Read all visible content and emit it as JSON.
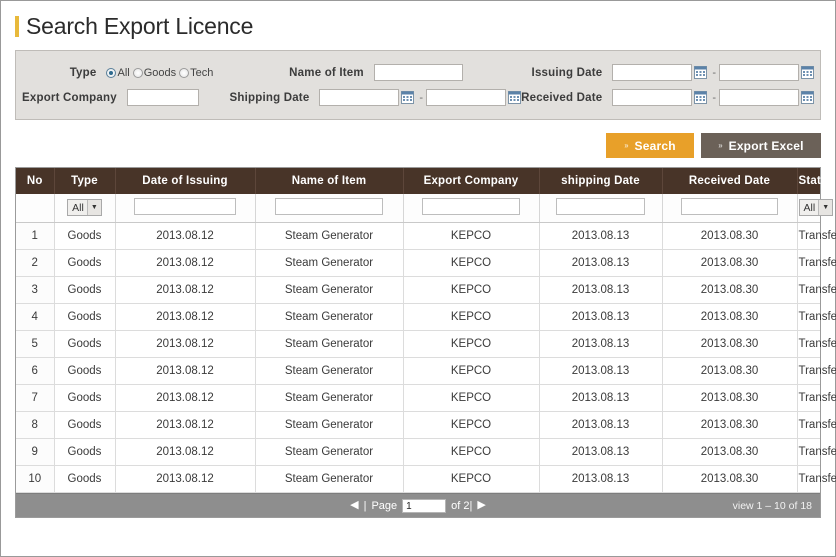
{
  "page_title": "Search Export Licence",
  "search_panel": {
    "type_label": "Type",
    "type_options": [
      {
        "label": "All",
        "selected": true
      },
      {
        "label": "Goods",
        "selected": false
      },
      {
        "label": "Tech",
        "selected": false
      }
    ],
    "name_of_item_label": "Name of Item",
    "name_of_item_value": "",
    "issuing_date_label": "Issuing Date",
    "issuing_date_from": "",
    "issuing_date_to": "",
    "export_company_label": "Export Company",
    "export_company_value": "",
    "shipping_date_label": "Shipping Date",
    "shipping_date_from": "",
    "shipping_date_to": "",
    "received_date_label": "Received Date",
    "received_date_from": "",
    "received_date_to": "",
    "date_separator": "-"
  },
  "actions": {
    "search_label": "Search",
    "export_excel_label": "Export Excel",
    "arrow_glyph": "››"
  },
  "table": {
    "columns": [
      "No",
      "Type",
      "Date of Issuing",
      "Name of Item",
      "Export Company",
      "shipping Date",
      "Received Date",
      "Status"
    ],
    "filters": {
      "type": {
        "kind": "select",
        "value": "All"
      },
      "date_of_issuing": {
        "kind": "text",
        "value": ""
      },
      "name_of_item": {
        "kind": "text",
        "value": ""
      },
      "export_company": {
        "kind": "text",
        "value": ""
      },
      "shipping_date": {
        "kind": "text",
        "value": ""
      },
      "received_date": {
        "kind": "text",
        "value": ""
      },
      "status": {
        "kind": "select",
        "value": "All"
      }
    },
    "rows": [
      {
        "no": "1",
        "type": "Goods",
        "date_of_issuing": "2013.08.12",
        "name_of_item": "Steam Generator",
        "export_company": "KEPCO",
        "shipping_date": "2013.08.13",
        "received_date": "2013.08.30",
        "status": "Transferred"
      },
      {
        "no": "2",
        "type": "Goods",
        "date_of_issuing": "2013.08.12",
        "name_of_item": "Steam Generator",
        "export_company": "KEPCO",
        "shipping_date": "2013.08.13",
        "received_date": "2013.08.30",
        "status": "Transferred"
      },
      {
        "no": "3",
        "type": "Goods",
        "date_of_issuing": "2013.08.12",
        "name_of_item": "Steam Generator",
        "export_company": "KEPCO",
        "shipping_date": "2013.08.13",
        "received_date": "2013.08.30",
        "status": "Transferred"
      },
      {
        "no": "4",
        "type": "Goods",
        "date_of_issuing": "2013.08.12",
        "name_of_item": "Steam Generator",
        "export_company": "KEPCO",
        "shipping_date": "2013.08.13",
        "received_date": "2013.08.30",
        "status": "Transferred"
      },
      {
        "no": "5",
        "type": "Goods",
        "date_of_issuing": "2013.08.12",
        "name_of_item": "Steam Generator",
        "export_company": "KEPCO",
        "shipping_date": "2013.08.13",
        "received_date": "2013.08.30",
        "status": "Transferred"
      },
      {
        "no": "6",
        "type": "Goods",
        "date_of_issuing": "2013.08.12",
        "name_of_item": "Steam Generator",
        "export_company": "KEPCO",
        "shipping_date": "2013.08.13",
        "received_date": "2013.08.30",
        "status": "Transferred"
      },
      {
        "no": "7",
        "type": "Goods",
        "date_of_issuing": "2013.08.12",
        "name_of_item": "Steam Generator",
        "export_company": "KEPCO",
        "shipping_date": "2013.08.13",
        "received_date": "2013.08.30",
        "status": "Transferred"
      },
      {
        "no": "8",
        "type": "Goods",
        "date_of_issuing": "2013.08.12",
        "name_of_item": "Steam Generator",
        "export_company": "KEPCO",
        "shipping_date": "2013.08.13",
        "received_date": "2013.08.30",
        "status": "Transferred"
      },
      {
        "no": "9",
        "type": "Goods",
        "date_of_issuing": "2013.08.12",
        "name_of_item": "Steam Generator",
        "export_company": "KEPCO",
        "shipping_date": "2013.08.13",
        "received_date": "2013.08.30",
        "status": "Transferred"
      },
      {
        "no": "10",
        "type": "Goods",
        "date_of_issuing": "2013.08.12",
        "name_of_item": "Steam Generator",
        "export_company": "KEPCO",
        "shipping_date": "2013.08.13",
        "received_date": "2013.08.30",
        "status": "Transferred"
      }
    ]
  },
  "footer": {
    "prev_glyph": "◀",
    "next_glyph": "▶",
    "pipe": "|",
    "page_label": "Page",
    "page_value": "1",
    "of_label": "of 2|",
    "view_count": "view 1 – 10 of 18"
  },
  "colors": {
    "accent_gold": "#e8b93b",
    "search_button": "#e8a029",
    "export_button": "#6b6158",
    "table_header": "#483428",
    "footer_bar": "#8e8e8e",
    "panel_bg": "#e2e0dd"
  }
}
